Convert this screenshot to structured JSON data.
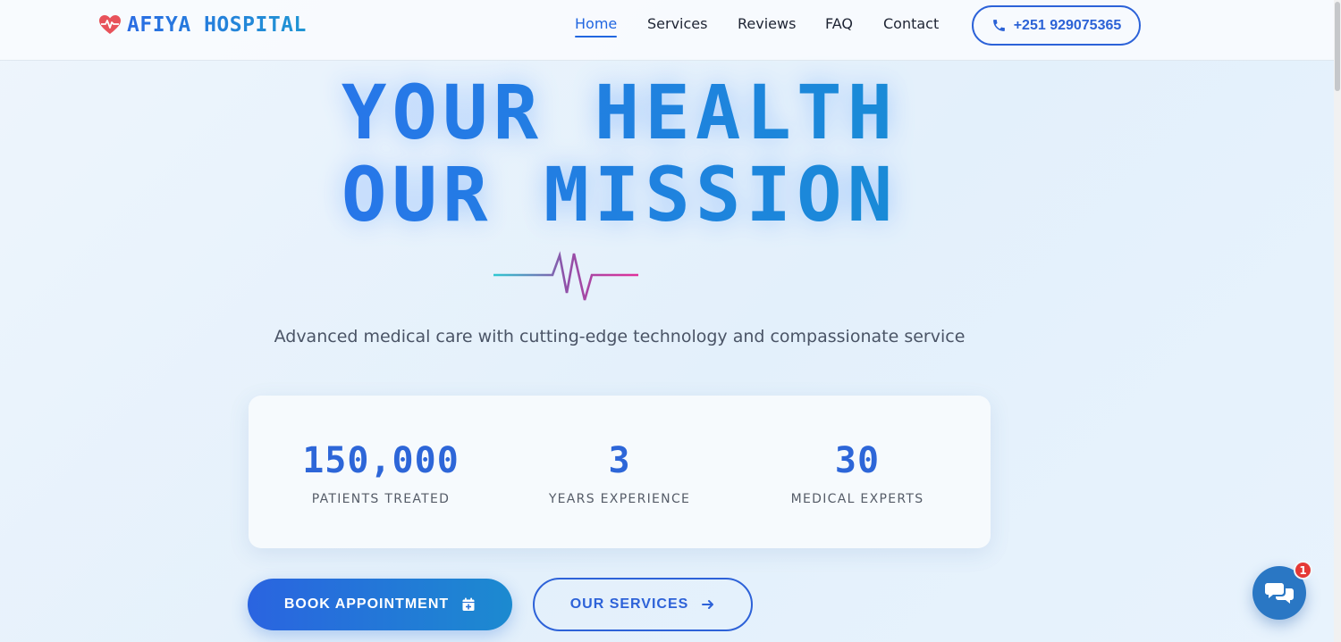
{
  "header": {
    "logo_text": "AFIYA HOSPITAL",
    "logo_icon": "heart-pulse-icon",
    "nav": [
      {
        "label": "Home",
        "active": true
      },
      {
        "label": "Services",
        "active": false
      },
      {
        "label": "Reviews",
        "active": false
      },
      {
        "label": "FAQ",
        "active": false
      },
      {
        "label": "Contact",
        "active": false
      }
    ],
    "phone": "+251 929075365",
    "phone_icon": "phone-icon"
  },
  "hero": {
    "title_line1": "YOUR HEALTH",
    "title_line2": "OUR MISSION",
    "subtitle": "Advanced medical care with cutting-edge technology and compassionate service"
  },
  "stats": [
    {
      "value": "150,000",
      "label": "PATIENTS TREATED"
    },
    {
      "value": "3",
      "label": "YEARS EXPERIENCE"
    },
    {
      "value": "30",
      "label": "MEDICAL EXPERTS"
    }
  ],
  "buttons": {
    "book": "BOOK APPOINTMENT",
    "book_icon": "calendar-plus-icon",
    "services": "OUR SERVICES",
    "services_icon": "arrow-right-icon"
  },
  "chat": {
    "icon": "chat-bubbles-icon",
    "badge": "1"
  },
  "colors": {
    "primary": "#2d66d8",
    "accent": "#1c8ad0",
    "logo_heart": "#e8525a",
    "badge": "#e53935"
  }
}
